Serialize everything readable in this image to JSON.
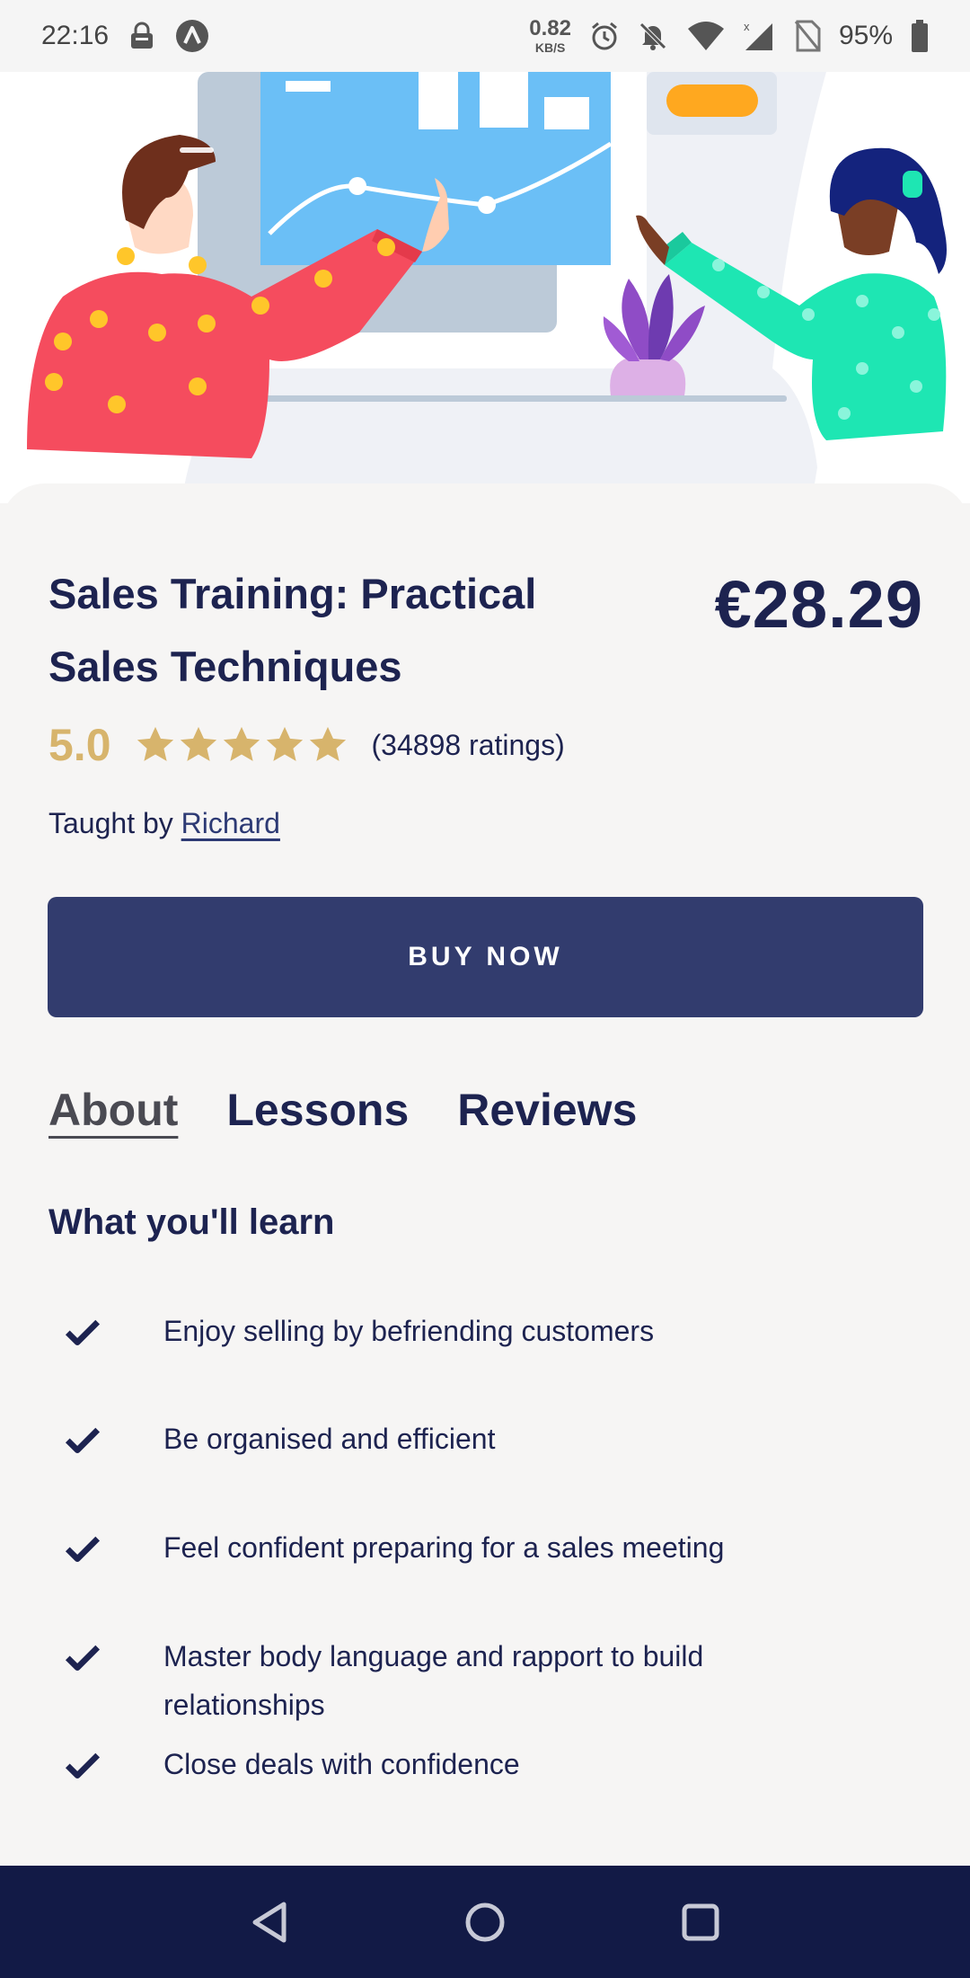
{
  "status_bar": {
    "time": "22:16",
    "net_speed_value": "0.82",
    "net_speed_unit": "KB/S",
    "battery": "95%"
  },
  "course": {
    "title": "Sales Training: Practical Sales Techniques",
    "price": "€28.29",
    "rating": "5.0",
    "stars": 5,
    "ratings_count": "(34898 ratings)",
    "taught_by_label": "Taught by",
    "instructor": "Richard"
  },
  "buy_button_label": "BUY NOW",
  "tabs": [
    {
      "label": "About",
      "active": true
    },
    {
      "label": "Lessons",
      "active": false
    },
    {
      "label": "Reviews",
      "active": false
    }
  ],
  "learn": {
    "heading": "What you'll learn",
    "items": [
      "Enjoy selling by befriending customers",
      "Be organised and efficient",
      "Feel confident preparing for a sales meeting",
      "Master body language and rapport to build relationships",
      "Close deals with confidence"
    ]
  },
  "colors": {
    "navy": "#1d2350",
    "button": "#323c6e",
    "gold": "#d7b46c",
    "nav_bar": "#121a46",
    "background": "#f6f5f4"
  },
  "icons": [
    "lock-icon",
    "app-icon",
    "alarm-icon",
    "mute-icon",
    "wifi-icon",
    "signal-icon",
    "no-sim-icon",
    "battery-icon",
    "star-icon",
    "check-icon",
    "back-icon",
    "home-icon",
    "recents-icon"
  ]
}
